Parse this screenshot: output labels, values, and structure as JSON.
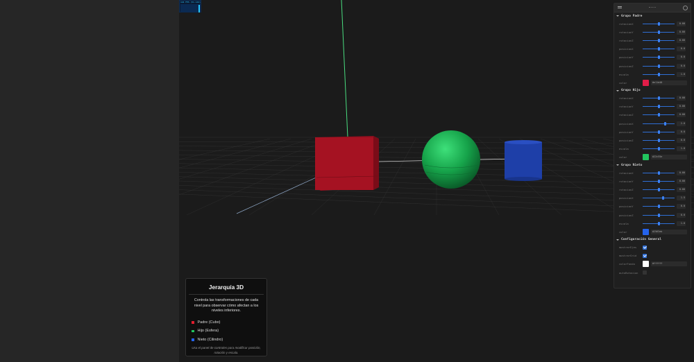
{
  "stats": {
    "text": "144 FPS (51-144)"
  },
  "info_panel": {
    "title": "Jerarquía 3D",
    "description": "Controla las transformaciones de cada nivel para observar cómo afectan a los niveles inferiores.",
    "legend": [
      {
        "label": "Padre (Cubo)",
        "color": "#e11d2e"
      },
      {
        "label": "Hijo (Esfera)",
        "color": "#22c55e"
      },
      {
        "label": "Nieto (Cilindro)",
        "color": "#2563eb"
      }
    ],
    "hint": "Usa el panel de controles para modificar posición, rotación y escala."
  },
  "gui": {
    "folders": [
      {
        "title": "Grupo Padre",
        "rows": [
          {
            "type": "slider",
            "label": "rotacionX",
            "value": "0.00",
            "level": 0.5
          },
          {
            "type": "slider",
            "label": "rotacionY",
            "value": "0.00",
            "level": 0.5
          },
          {
            "type": "slider",
            "label": "rotacionZ",
            "value": "0.00",
            "level": 0.5
          },
          {
            "type": "slider",
            "label": "posicionX",
            "value": "0.0",
            "level": 0.5
          },
          {
            "type": "slider",
            "label": "posicionY",
            "value": "0.0",
            "level": 0.5
          },
          {
            "type": "slider",
            "label": "posicionZ",
            "value": "0.0",
            "level": 0.5
          },
          {
            "type": "slider",
            "label": "escala",
            "value": "1.0",
            "level": 0.5
          },
          {
            "type": "color",
            "label": "color",
            "value": "#e11d48",
            "swatch": "#e11d48"
          }
        ]
      },
      {
        "title": "Grupo Hijo",
        "rows": [
          {
            "type": "slider",
            "label": "rotacionX",
            "value": "0.00",
            "level": 0.5
          },
          {
            "type": "slider",
            "label": "rotacionY",
            "value": "0.00",
            "level": 0.5
          },
          {
            "type": "slider",
            "label": "rotacionZ",
            "value": "0.00",
            "level": 0.5
          },
          {
            "type": "slider",
            "label": "posicionX",
            "value": "2.0",
            "level": 0.7
          },
          {
            "type": "slider",
            "label": "posicionY",
            "value": "0.0",
            "level": 0.5
          },
          {
            "type": "slider",
            "label": "posicionZ",
            "value": "0.0",
            "level": 0.5
          },
          {
            "type": "slider",
            "label": "escala",
            "value": "1.0",
            "level": 0.5
          },
          {
            "type": "color",
            "label": "color",
            "value": "#22c55e",
            "swatch": "#22c55e"
          }
        ]
      },
      {
        "title": "Grupo Nieto",
        "rows": [
          {
            "type": "slider",
            "label": "rotacionX",
            "value": "0.00",
            "level": 0.5
          },
          {
            "type": "slider",
            "label": "rotacionY",
            "value": "0.00",
            "level": 0.5
          },
          {
            "type": "slider",
            "label": "rotacionZ",
            "value": "0.00",
            "level": 0.5
          },
          {
            "type": "slider",
            "label": "posicionX",
            "value": "1.5",
            "level": 0.65
          },
          {
            "type": "slider",
            "label": "posicionY",
            "value": "0.0",
            "level": 0.5
          },
          {
            "type": "slider",
            "label": "posicionZ",
            "value": "0.0",
            "level": 0.5
          },
          {
            "type": "slider",
            "label": "escala",
            "value": "1.0",
            "level": 0.5
          },
          {
            "type": "color",
            "label": "color",
            "value": "#2563eb",
            "swatch": "#2563eb"
          }
        ]
      },
      {
        "title": "Configuración General",
        "rows": [
          {
            "type": "check",
            "label": "mostrarEjes",
            "checked": true
          },
          {
            "type": "check",
            "label": "mostrarGrid",
            "checked": true
          },
          {
            "type": "color",
            "label": "colorFondo",
            "value": "#ffffff",
            "swatch": "#ffffff"
          },
          {
            "type": "check",
            "label": "autoRotacion",
            "checked": false
          }
        ]
      }
    ]
  },
  "colors": {
    "cube": "#a51222",
    "sphere": "#16a34a",
    "cylinder": "#1e3fa8",
    "axis_y": "#4ade80",
    "axis_x": "#d4d4d4",
    "grid": "#3a3a3a"
  }
}
